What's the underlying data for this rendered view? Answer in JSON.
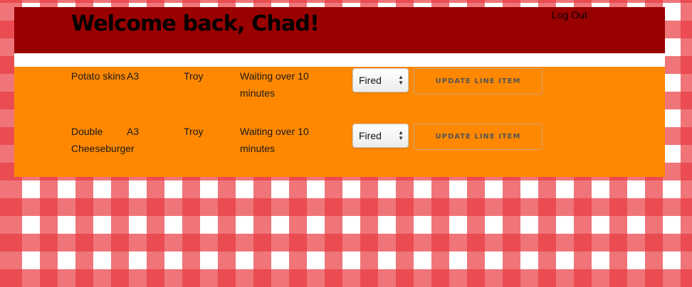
{
  "header": {
    "welcome": "Welcome back, Chad!",
    "logout_label": "Log Out"
  },
  "orders": [
    {
      "item": "Potato skins",
      "table": "A3",
      "server": "Troy",
      "status": "Waiting over 10 minutes",
      "state": "Fired",
      "button_label": "Update Line Item"
    },
    {
      "item": "Double Cheeseburger",
      "table": "A3",
      "server": "Troy",
      "status": "Waiting over 10 minutes",
      "state": "Fired",
      "button_label": "Update Line Item"
    }
  ],
  "colors": {
    "header_bg": "#990000",
    "orders_bg": "#ff8800",
    "tablecloth_red": "#e83a40"
  }
}
